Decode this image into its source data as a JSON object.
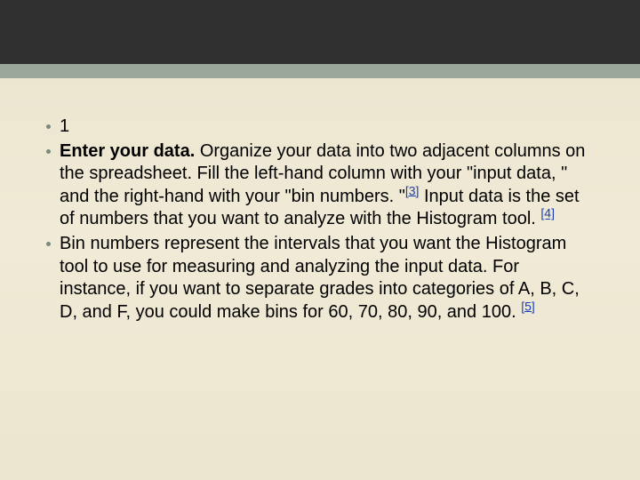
{
  "bullets": {
    "b1": {
      "text": "1"
    },
    "b2": {
      "lead": "Enter your data.",
      "part1": " Organize your data into two adjacent columns on the spreadsheet. Fill the left-hand column with your \"input data, \" and the right-hand with your \"bin numbers. \"",
      "cite1": "[3]",
      "part2": " Input data is the set of numbers that you want to analyze with the Histogram tool. ",
      "cite2": "[4]"
    },
    "b3": {
      "text": "Bin numbers represent the intervals that you want the Histogram tool to use for measuring and analyzing the input data. For instance, if you want to separate grades into categories of A, B, C, D, and F, you could make bins for 60, 70, 80, 90, and 100. ",
      "cite": "[5]"
    }
  }
}
